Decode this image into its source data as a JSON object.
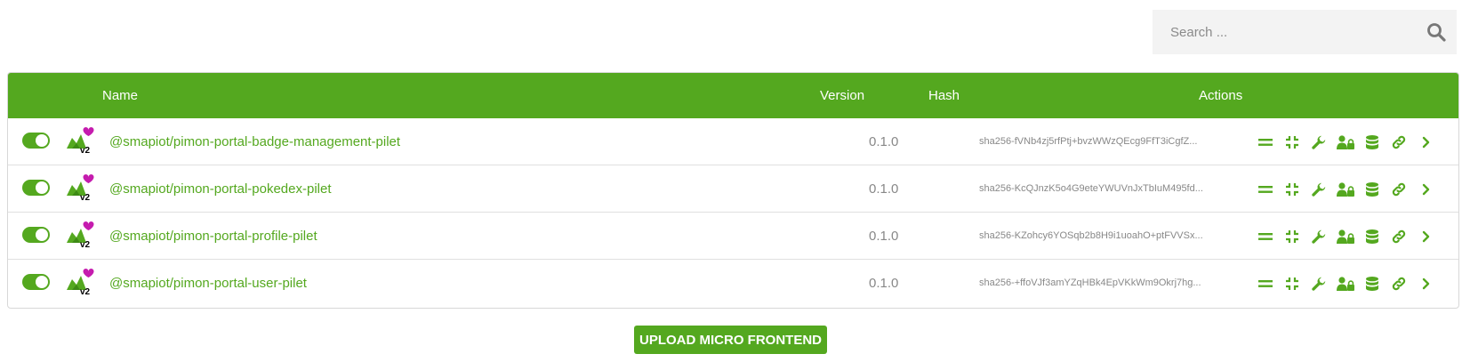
{
  "search": {
    "placeholder": "Search ..."
  },
  "table": {
    "headers": {
      "name": "Name",
      "version": "Version",
      "hash": "Hash",
      "actions": "Actions"
    },
    "rows": [
      {
        "enabled": true,
        "name": "@smapiot/pimon-portal-badge-management-pilet",
        "version": "0.1.0",
        "hash": "sha256-fVNb4zj5rfPtj+bvzWWzQEcg9FfT3iCgfZ..."
      },
      {
        "enabled": true,
        "name": "@smapiot/pimon-portal-pokedex-pilet",
        "version": "0.1.0",
        "hash": "sha256-KcQJnzK5o4G9eteYWUVnJxTbIuM495fd..."
      },
      {
        "enabled": true,
        "name": "@smapiot/pimon-portal-profile-pilet",
        "version": "0.1.0",
        "hash": "sha256-KZohcy6YOSqb2b8H9i1uoahO+ptFVVSx..."
      },
      {
        "enabled": true,
        "name": "@smapiot/pimon-portal-user-pilet",
        "version": "0.1.0",
        "hash": "sha256-+ffoVJf3amYZqHBk4EpVKkWm9Okrj7hg..."
      }
    ],
    "row_icon_label": "v2"
  },
  "actions": [
    "menu-icon",
    "compress-icon",
    "wrench-icon",
    "user-lock-icon",
    "database-icon",
    "link-icon",
    "chevron-right-icon"
  ],
  "upload_button": {
    "label": "UPLOAD MICRO FRONTEND"
  },
  "colors": {
    "accent": "#54a81f",
    "badge": "#c51cae"
  }
}
